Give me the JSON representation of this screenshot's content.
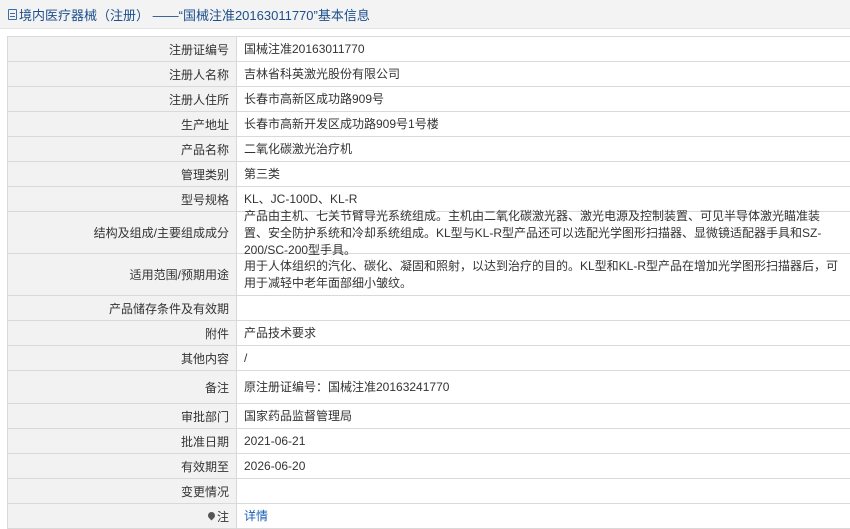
{
  "header": {
    "title": "境内医疗器械（注册） ——“国械注准20163011770”基本信息"
  },
  "rows": [
    {
      "label": "注册证编号",
      "value": "国械注准20163011770"
    },
    {
      "label": "注册人名称",
      "value": "吉林省科英激光股份有限公司"
    },
    {
      "label": "注册人住所",
      "value": "长春市高新区成功路909号"
    },
    {
      "label": "生产地址",
      "value": "长春市高新开发区成功路909号1号楼"
    },
    {
      "label": "产品名称",
      "value": "二氧化碳激光治疗机"
    },
    {
      "label": "管理类别",
      "value": "第三类"
    },
    {
      "label": "型号规格",
      "value": "KL、JC-100D、KL-R"
    },
    {
      "label": "结构及组成/主要组成成分",
      "value": "产品由主机、七关节臂导光系统组成。主机由二氧化碳激光器、激光电源及控制装置、可见半导体激光瞄准装置、安全防护系统和冷却系统组成。KL型与KL-R型产品还可以选配光学图形扫描器、显微镜适配器手具和SZ-200/SC-200型手具。"
    },
    {
      "label": "适用范围/预期用途",
      "value": "用于人体组织的汽化、碳化、凝固和照射，以达到治疗的目的。KL型和KL-R型产品在增加光学图形扫描器后，可用于减轻中老年面部细小皱纹。"
    },
    {
      "label": "产品储存条件及有效期",
      "value": ""
    },
    {
      "label": "附件",
      "value": "产品技术要求"
    },
    {
      "label": "其他内容",
      "value": "/"
    },
    {
      "label": "备注",
      "value": "原注册证编号：国械注准20163241770"
    },
    {
      "label": "审批部门",
      "value": "国家药品监督管理局"
    },
    {
      "label": "批准日期",
      "value": "2021-06-21"
    },
    {
      "label": "有效期至",
      "value": "2026-06-20"
    },
    {
      "label": "变更情况",
      "value": ""
    },
    {
      "label": "注",
      "value": "详情"
    }
  ]
}
